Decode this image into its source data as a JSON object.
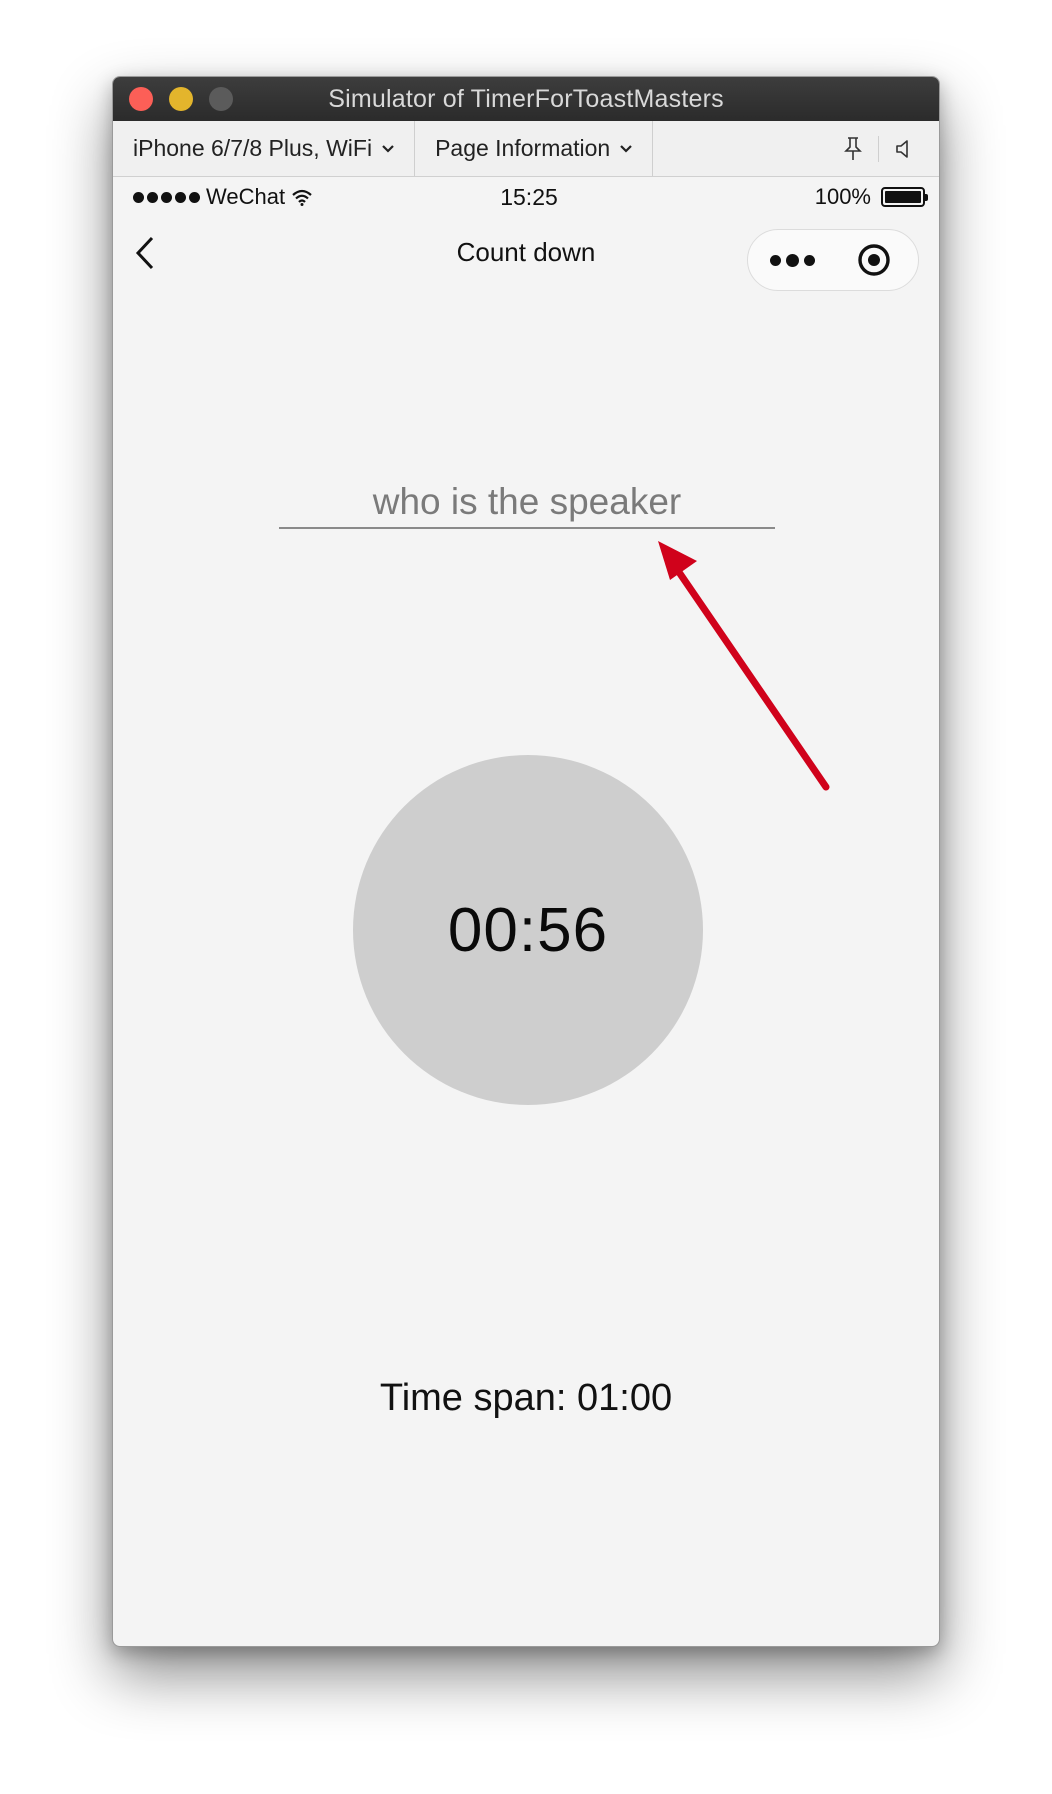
{
  "window": {
    "title": "Simulator of TimerForToastMasters"
  },
  "toolbar": {
    "device_label": "iPhone 6/7/8 Plus, WiFi",
    "page_info_label": "Page Information",
    "icons": [
      "pin-icon",
      "speaker-icon"
    ]
  },
  "status_bar": {
    "carrier": "WeChat",
    "time": "15:25",
    "battery": "100%"
  },
  "nav": {
    "title": "Count down",
    "icons": [
      "back-arrow-icon",
      "more-dots-icon",
      "record-target-icon"
    ]
  },
  "main": {
    "speaker_placeholder": "who is the speaker",
    "speaker_value": "",
    "countdown": "00:56",
    "time_span_label": "Time span:",
    "time_span_value": "01:00"
  },
  "annotation": {
    "arrow_color": "#d0021b"
  },
  "colors": {
    "titlebar": "#2b2b2b",
    "page_bg": "#f4f4f4",
    "timer_circle": "#cecece",
    "close_light": "#fc5f57",
    "minimize_light": "#e3b52c",
    "zoom_light": "#5b5b5b"
  }
}
